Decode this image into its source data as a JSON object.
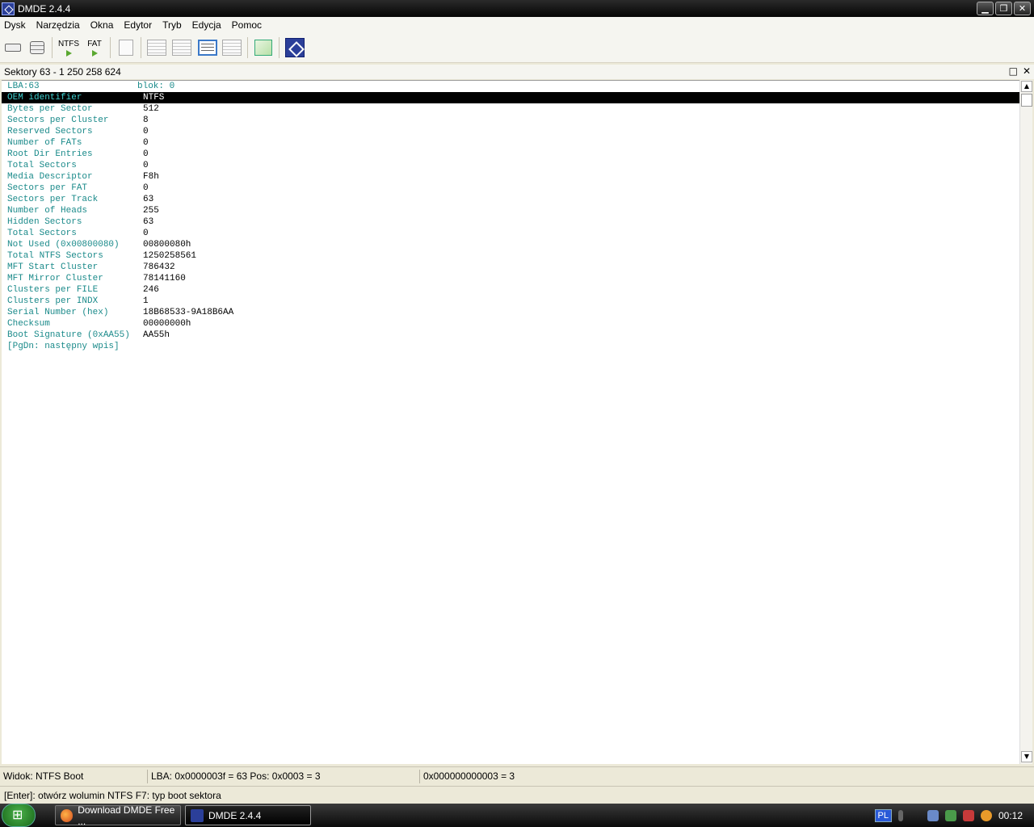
{
  "window": {
    "title": "DMDE 2.4.4"
  },
  "menu": [
    "Dysk",
    "Narzędzia",
    "Okna",
    "Edytor",
    "Tryb",
    "Edycja",
    "Pomoc"
  ],
  "toolbar": {
    "ntfs_label": "NTFS",
    "fat_label": "FAT"
  },
  "panel": {
    "title": "Sektory 63 - 1 250 258 624"
  },
  "boot": {
    "header_key": "LBA:63",
    "header_value": "blok: 0",
    "rows": [
      {
        "k": "OEM identifier",
        "v": "NTFS"
      },
      {
        "k": "Bytes per Sector",
        "v": "512"
      },
      {
        "k": "Sectors per Cluster",
        "v": "8"
      },
      {
        "k": "Reserved Sectors",
        "v": "0"
      },
      {
        "k": "Number of FATs",
        "v": "0"
      },
      {
        "k": "Root Dir Entries",
        "v": "0"
      },
      {
        "k": "Total Sectors",
        "v": "0"
      },
      {
        "k": "Media Descriptor",
        "v": "F8h"
      },
      {
        "k": "Sectors per FAT",
        "v": "0"
      },
      {
        "k": "Sectors per Track",
        "v": "63"
      },
      {
        "k": "Number of Heads",
        "v": "255"
      },
      {
        "k": "Hidden Sectors",
        "v": "63"
      },
      {
        "k": "Total Sectors",
        "v": "0"
      },
      {
        "k": "Not Used (0x00800080)",
        "v": "00800080h"
      },
      {
        "k": "Total NTFS Sectors",
        "v": "1250258561"
      },
      {
        "k": "MFT Start Cluster",
        "v": "786432"
      },
      {
        "k": "MFT Mirror Cluster",
        "v": "78141160"
      },
      {
        "k": "Clusters per FILE",
        "v": "246"
      },
      {
        "k": "Clusters per INDX",
        "v": "1"
      },
      {
        "k": "Serial Number (hex)",
        "v": "18B68533-9A18B6AA"
      },
      {
        "k": "Checksum",
        "v": "00000000h"
      },
      {
        "k": "Boot Signature (0xAA55)",
        "v": "AA55h"
      }
    ],
    "footer": "[PgDn: następny wpis]"
  },
  "status": {
    "view": "Widok: NTFS Boot",
    "lba": "LBA: 0x0000003f = 63  Pos: 0x0003 = 3",
    "value": "0x000000000003 = 3"
  },
  "hint": "[Enter]: otwórz wolumin NTFS   F7: typ boot sektora",
  "taskbar": {
    "tasks": [
      "Download DMDE Free ...",
      "DMDE 2.4.4"
    ],
    "lang": "PL",
    "clock": "00:12"
  },
  "colors": {
    "key": "#1a8a8a",
    "selected_bg": "#000000",
    "accent": "#2b3f99"
  }
}
